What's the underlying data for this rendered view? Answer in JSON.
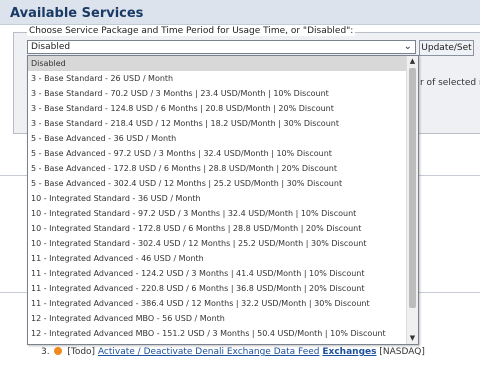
{
  "header": {
    "title": "Available Services"
  },
  "form": {
    "legend": "Choose Service Package and Time Period for Usage Time, or \"Disabled\":",
    "selected": "Disabled",
    "button_label": "Update/Set",
    "trailing_text": "r of selected m"
  },
  "dropdown": {
    "options": [
      "Disabled",
      "3 - Base Standard - 26 USD / Month",
      "3 - Base Standard - 70.2 USD / 3 Months | 23.4 USD/Month | 10% Discount",
      "3 - Base Standard - 124.8 USD / 6 Months | 20.8 USD/Month | 20% Discount",
      "3 - Base Standard - 218.4 USD / 12 Months | 18.2 USD/Month | 30% Discount",
      "5 - Base Advanced - 36 USD / Month",
      "5 - Base Advanced - 97.2 USD / 3 Months | 32.4 USD/Month | 10% Discount",
      "5 - Base Advanced - 172.8 USD / 6 Months | 28.8 USD/Month | 20% Discount",
      "5 - Base Advanced - 302.4 USD / 12 Months | 25.2 USD/Month | 30% Discount",
      "10 - Integrated Standard - 36 USD / Month",
      "10 - Integrated Standard - 97.2 USD / 3 Months | 32.4 USD/Month | 10% Discount",
      "10 - Integrated Standard - 172.8 USD / 6 Months | 28.8 USD/Month | 20% Discount",
      "10 - Integrated Standard - 302.4 USD / 12 Months | 25.2 USD/Month | 30% Discount",
      "11 - Integrated Advanced - 46 USD / Month",
      "11 - Integrated Advanced - 124.2 USD / 3 Months | 41.4 USD/Month | 10% Discount",
      "11 - Integrated Advanced - 220.8 USD / 6 Months | 36.8 USD/Month | 20% Discount",
      "11 - Integrated Advanced - 386.4 USD / 12 Months | 32.2 USD/Month | 30% Discount",
      "12 - Integrated Advanced MBO - 56 USD / Month",
      "12 - Integrated Advanced MBO - 151.2 USD / 3 Months | 50.4 USD/Month | 10% Discount"
    ]
  },
  "todo": {
    "number": "3.",
    "tag": "[Todo]",
    "link_text": "Activate / Deactivate Denali Exchange Data Feed",
    "bold_text": "Exchanges",
    "suffix": "[NASDAQ]"
  },
  "colors": {
    "accent": "#1a3a66",
    "link": "#1c4f9c",
    "todo_dot": "#f08a1c"
  }
}
